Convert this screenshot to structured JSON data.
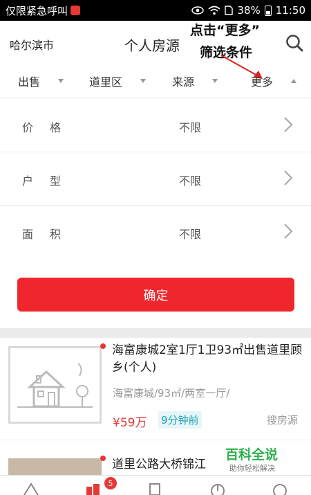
{
  "status_bar": {
    "carrier": "仅限紧急呼叫",
    "battery": "38%",
    "time": "11:50"
  },
  "header": {
    "city": "哈尔滨市",
    "title": "个人房源",
    "search_icon": "search-icon"
  },
  "annotation": {
    "line1": "点击“更多”",
    "line2": "筛选条件"
  },
  "filters": [
    {
      "label": "出售",
      "state": "collapsed"
    },
    {
      "label": "道里区",
      "state": "collapsed"
    },
    {
      "label": "来源",
      "state": "collapsed"
    },
    {
      "label": "更多",
      "state": "expanded"
    }
  ],
  "more_panel": {
    "rows": [
      {
        "label": "价格",
        "value": "不限"
      },
      {
        "label": "户型",
        "value": "不限"
      },
      {
        "label": "面积",
        "value": "不限"
      }
    ],
    "confirm_label": "确定"
  },
  "listings": [
    {
      "title": "海富康城2室1厅1卫93㎡出售道里顾乡(个人)",
      "subtitle": "海富康城/93㎡/两室一厅/",
      "price": "¥59万",
      "time": "9分钟前",
      "source": "搜房源"
    },
    {
      "title": "道里公路大桥锦江"
    }
  ],
  "watermark": {
    "main": "百科全说",
    "sub": "助你轻松解决"
  },
  "tabbar": {
    "badge_count": "5"
  },
  "colors": {
    "accent": "#f0262e",
    "time_badge": "#1aa2b5"
  }
}
